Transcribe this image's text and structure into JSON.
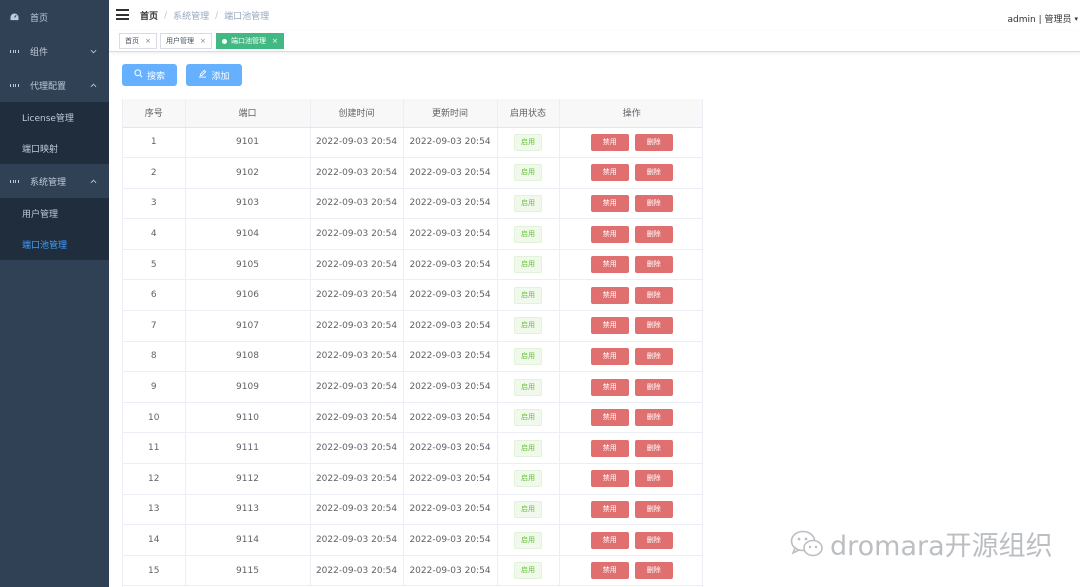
{
  "sidebar": {
    "items": [
      {
        "label": "首页",
        "icon": "dashboard-icon"
      },
      {
        "label": "组件",
        "icon": "grid-icon",
        "arrow": "chevron-down"
      },
      {
        "label": "代理配置",
        "icon": "grid-icon",
        "arrow": "chevron-up",
        "children": [
          {
            "label": "License管理"
          },
          {
            "label": "端口映射"
          }
        ]
      },
      {
        "label": "系统管理",
        "icon": "grid-icon",
        "arrow": "chevron-up",
        "children": [
          {
            "label": "用户管理"
          },
          {
            "label": "端口池管理",
            "active": true
          }
        ]
      }
    ]
  },
  "navbar": {
    "breadcrumb": [
      "首页",
      "系统管理",
      "端口池管理"
    ],
    "user": "admin | 管理员"
  },
  "tags": [
    {
      "label": "首页",
      "close": "×"
    },
    {
      "label": "用户管理",
      "close": "×"
    },
    {
      "label": "端口池管理",
      "close": "×",
      "active": true
    }
  ],
  "toolbar": {
    "search_label": "搜索",
    "add_label": "添加"
  },
  "table": {
    "columns": [
      "序号",
      "端口",
      "创建时间",
      "更新时间",
      "启用状态",
      "操作"
    ],
    "status_label": "启用",
    "disable_label": "禁用",
    "delete_label": "删除",
    "rows": [
      {
        "index": "1",
        "port": "9101",
        "created": "2022-09-03 20:54",
        "updated": "2022-09-03 20:54"
      },
      {
        "index": "2",
        "port": "9102",
        "created": "2022-09-03 20:54",
        "updated": "2022-09-03 20:54"
      },
      {
        "index": "3",
        "port": "9103",
        "created": "2022-09-03 20:54",
        "updated": "2022-09-03 20:54"
      },
      {
        "index": "4",
        "port": "9104",
        "created": "2022-09-03 20:54",
        "updated": "2022-09-03 20:54"
      },
      {
        "index": "5",
        "port": "9105",
        "created": "2022-09-03 20:54",
        "updated": "2022-09-03 20:54"
      },
      {
        "index": "6",
        "port": "9106",
        "created": "2022-09-03 20:54",
        "updated": "2022-09-03 20:54"
      },
      {
        "index": "7",
        "port": "9107",
        "created": "2022-09-03 20:54",
        "updated": "2022-09-03 20:54"
      },
      {
        "index": "8",
        "port": "9108",
        "created": "2022-09-03 20:54",
        "updated": "2022-09-03 20:54"
      },
      {
        "index": "9",
        "port": "9109",
        "created": "2022-09-03 20:54",
        "updated": "2022-09-03 20:54"
      },
      {
        "index": "10",
        "port": "9110",
        "created": "2022-09-03 20:54",
        "updated": "2022-09-03 20:54"
      },
      {
        "index": "11",
        "port": "9111",
        "created": "2022-09-03 20:54",
        "updated": "2022-09-03 20:54"
      },
      {
        "index": "12",
        "port": "9112",
        "created": "2022-09-03 20:54",
        "updated": "2022-09-03 20:54"
      },
      {
        "index": "13",
        "port": "9113",
        "created": "2022-09-03 20:54",
        "updated": "2022-09-03 20:54"
      },
      {
        "index": "14",
        "port": "9114",
        "created": "2022-09-03 20:54",
        "updated": "2022-09-03 20:54"
      },
      {
        "index": "15",
        "port": "9115",
        "created": "2022-09-03 20:54",
        "updated": "2022-09-03 20:54"
      }
    ]
  },
  "watermark": {
    "text": "dromara开源组织",
    "icon": "wechat-icon"
  },
  "colors": {
    "sidebar_bg": "#304156",
    "submenu_bg": "#1f2d3d",
    "active_link": "#409eff",
    "primary_button": "#66b1ff",
    "active_tag": "#42b983",
    "danger_button": "#e07070",
    "status_success": "#67c23a"
  }
}
